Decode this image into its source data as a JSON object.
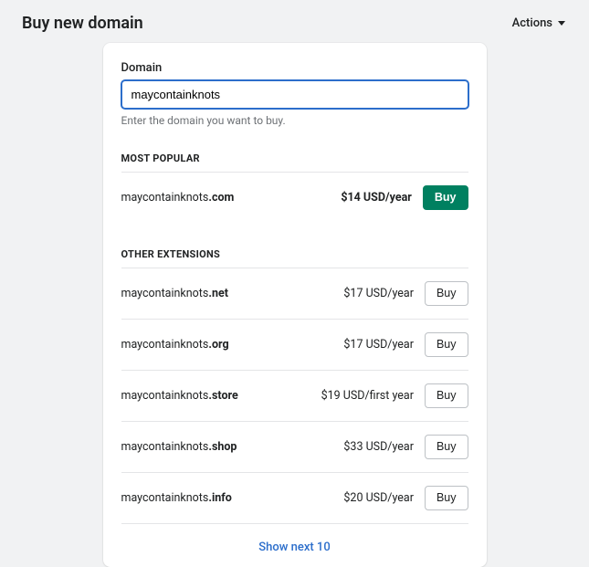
{
  "header": {
    "title": "Buy new domain",
    "actions_label": "Actions"
  },
  "search": {
    "label": "Domain",
    "value": "maycontainknots",
    "help": "Enter the domain you want to buy."
  },
  "sections": {
    "popular_title": "MOST POPULAR",
    "other_title": "OTHER EXTENSIONS"
  },
  "featured": {
    "base": "maycontainknots",
    "ext": ".com",
    "price": "$14 USD/year",
    "buy_label": "Buy"
  },
  "others": [
    {
      "base": "maycontainknots",
      "ext": ".net",
      "price": "$17 USD/year",
      "buy_label": "Buy"
    },
    {
      "base": "maycontainknots",
      "ext": ".org",
      "price": "$17 USD/year",
      "buy_label": "Buy"
    },
    {
      "base": "maycontainknots",
      "ext": ".store",
      "price": "$19 USD/first year",
      "buy_label": "Buy"
    },
    {
      "base": "maycontainknots",
      "ext": ".shop",
      "price": "$33 USD/year",
      "buy_label": "Buy"
    },
    {
      "base": "maycontainknots",
      "ext": ".info",
      "price": "$20 USD/year",
      "buy_label": "Buy"
    }
  ],
  "footer": {
    "show_next": "Show next 10"
  }
}
